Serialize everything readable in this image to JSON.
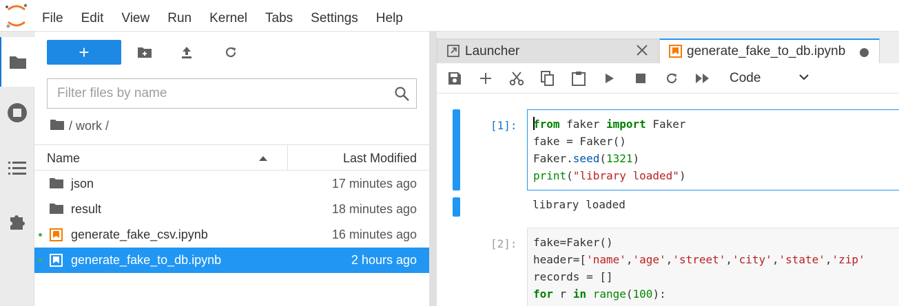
{
  "menu": [
    "File",
    "Edit",
    "View",
    "Run",
    "Kernel",
    "Tabs",
    "Settings",
    "Help"
  ],
  "filebrowser": {
    "new_label": "+",
    "filter_placeholder": "Filter files by name",
    "breadcrumb": "/ work /",
    "col_name": "Name",
    "col_modified": "Last Modified",
    "files": [
      {
        "name": "json",
        "modified": "17 minutes ago",
        "type": "folder",
        "running": false,
        "selected": false
      },
      {
        "name": "result",
        "modified": "18 minutes ago",
        "type": "folder",
        "running": false,
        "selected": false
      },
      {
        "name": "generate_fake_csv.ipynb",
        "modified": "16 minutes ago",
        "type": "notebook",
        "running": true,
        "selected": false
      },
      {
        "name": "generate_fake_to_db.ipynb",
        "modified": "2 hours ago",
        "type": "notebook",
        "running": true,
        "selected": true
      }
    ]
  },
  "tabs": {
    "launcher": "Launcher",
    "notebook": "generate_fake_to_db.ipynb"
  },
  "notebook": {
    "cell_type": "Code",
    "cells": [
      {
        "prompt": "[1]:",
        "lines": [
          "from faker import Faker",
          "fake = Faker()",
          "Faker.seed(1321)",
          "print(\"library loaded\")"
        ],
        "output": "library loaded"
      },
      {
        "prompt": "[2]:",
        "lines": [
          "fake=Faker()",
          "header=['name','age','street','city','state','zip'",
          "records = []",
          "for r in range(100):"
        ]
      }
    ]
  },
  "colors": {
    "accent": "#2196f3",
    "new_button": "#1e88e5",
    "notebook_icon": "#f57c00"
  }
}
